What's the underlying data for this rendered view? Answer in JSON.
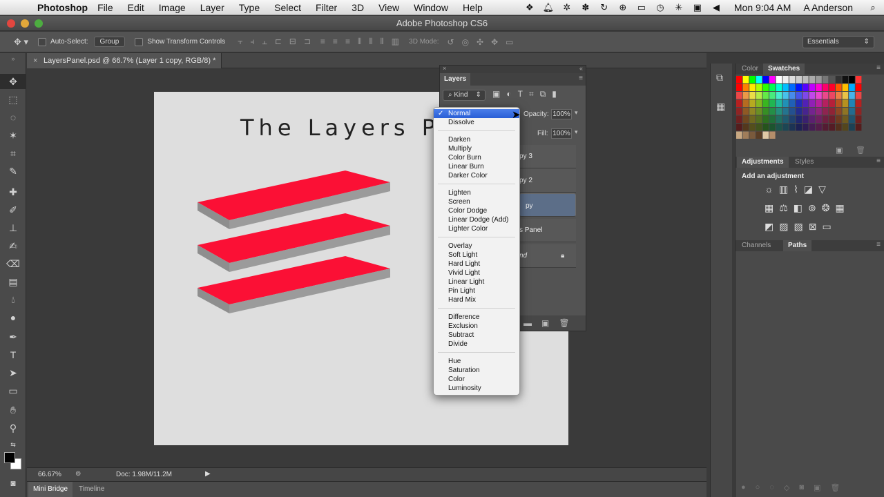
{
  "menubar": {
    "app": "Photoshop",
    "menus": [
      "File",
      "Edit",
      "Image",
      "Layer",
      "Type",
      "Select",
      "Filter",
      "3D",
      "View",
      "Window",
      "Help"
    ],
    "clock": "Mon 9:04 AM",
    "user": "A Anderson"
  },
  "window": {
    "title": "Adobe Photoshop CS6"
  },
  "options": {
    "auto_select_label": "Auto-Select:",
    "auto_select_value": "Group",
    "show_transform_label": "Show Transform Controls",
    "mode_3d_label": "3D Mode:",
    "workspace": "Essentials"
  },
  "document": {
    "tab_title": "LayersPanel.psd @ 66.7% (Layer 1 copy, RGB/8) *",
    "heading": "The Layers P",
    "shape_color": "#fb1035"
  },
  "status": {
    "zoom": "66.67%",
    "doc_size": "Doc: 1.98M/11.2M"
  },
  "bottom_tabs": [
    "Mini Bridge",
    "Timeline"
  ],
  "panels": {
    "color_tab": "Color",
    "swatches_tab": "Swatches",
    "adjustments_tab": "Adjustments",
    "styles_tab": "Styles",
    "add_adjustment": "Add an adjustment",
    "channels_tab": "Channels",
    "paths_tab": "Paths"
  },
  "layers_panel": {
    "title": "Layers",
    "kind": "Kind",
    "opacity_label": "Opacity:",
    "opacity_value": "100%",
    "fill_label": "Fill:",
    "fill_value": "100%",
    "rows": [
      "py 3",
      "py 2",
      "py",
      "s Panel",
      "nd"
    ]
  },
  "blend_modes": {
    "selected": "Normal",
    "groups": [
      [
        "Normal",
        "Dissolve"
      ],
      [
        "Darken",
        "Multiply",
        "Color Burn",
        "Linear Burn",
        "Darker Color"
      ],
      [
        "Lighten",
        "Screen",
        "Color Dodge",
        "Linear Dodge (Add)",
        "Lighter Color"
      ],
      [
        "Overlay",
        "Soft Light",
        "Hard Light",
        "Vivid Light",
        "Linear Light",
        "Pin Light",
        "Hard Mix"
      ],
      [
        "Difference",
        "Exclusion",
        "Subtract",
        "Divide"
      ],
      [
        "Hue",
        "Saturation",
        "Color",
        "Luminosity"
      ]
    ]
  }
}
